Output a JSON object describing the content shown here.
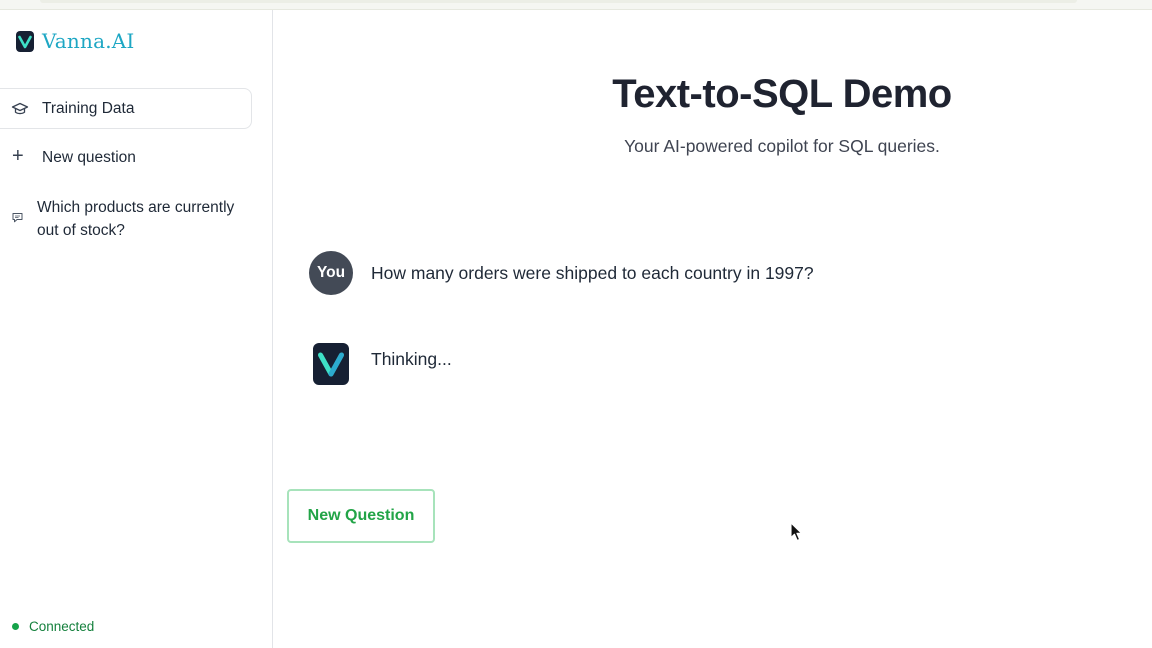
{
  "brand": {
    "name": "Vanna.AI",
    "logo_icon": "vanna-logo-icon"
  },
  "sidebar": {
    "training_data": {
      "label": "Training Data",
      "icon": "graduation-cap-icon"
    },
    "new_question": {
      "label": "New question",
      "icon": "plus-icon"
    },
    "history": [
      {
        "label": "Which products are currently out of stock?",
        "icon": "chat-bubble-icon"
      }
    ],
    "status": {
      "label": "Connected",
      "color": "#16a34a"
    }
  },
  "main": {
    "title": "Text-to-SQL Demo",
    "subtitle": "Your AI-powered copilot for SQL queries.",
    "messages": [
      {
        "role": "user",
        "avatar_label": "You",
        "text": "How many orders were shipped to each country in 1997?"
      },
      {
        "role": "assistant",
        "avatar_icon": "vanna-logo-icon",
        "text": "Thinking..."
      }
    ],
    "new_question_button": "New Question"
  },
  "colors": {
    "brand": "#1ea7c4",
    "accent_green": "#22a447",
    "avatar_user": "#434a56"
  }
}
